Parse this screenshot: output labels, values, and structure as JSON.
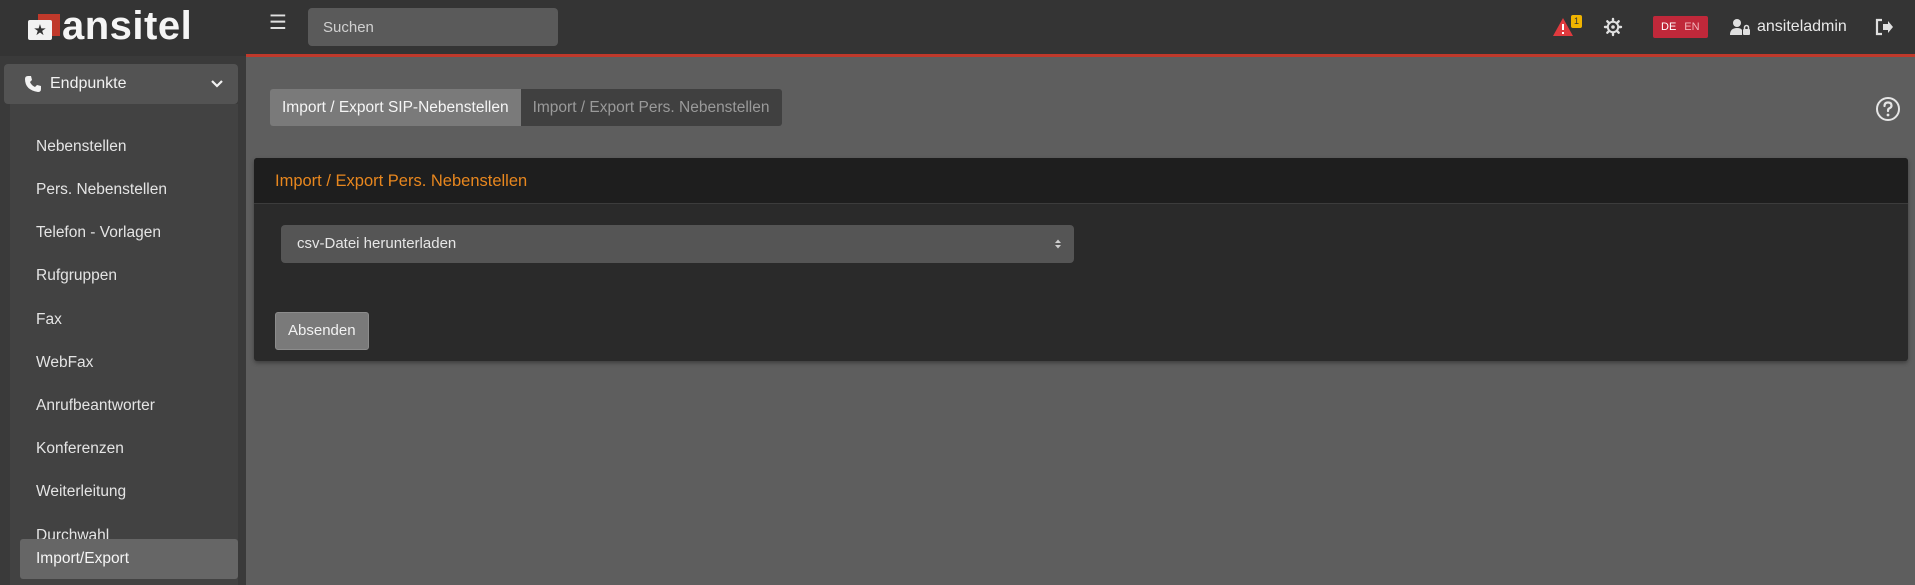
{
  "header": {
    "logo_text": "ansitel",
    "search_placeholder": "Suchen",
    "alerts_count": "1",
    "lang_active": "DE",
    "lang_other": "EN",
    "username": "ansiteladmin"
  },
  "sidebar": {
    "section_label": "Endpunkte",
    "items": [
      {
        "label": "Nebenstellen"
      },
      {
        "label": "Pers. Nebenstellen"
      },
      {
        "label": "Telefon - Vorlagen"
      },
      {
        "label": "Rufgruppen"
      },
      {
        "label": "Fax"
      },
      {
        "label": "WebFax"
      },
      {
        "label": "Anrufbeantworter"
      },
      {
        "label": "Konferenzen"
      },
      {
        "label": "Weiterleitung"
      },
      {
        "label": "Durchwahl"
      },
      {
        "label": "Import/Export"
      }
    ],
    "active_item": "Import/Export"
  },
  "main": {
    "tabs": [
      {
        "label": "Import / Export SIP-Nebenstellen",
        "active": true
      },
      {
        "label": "Import / Export Pers. Nebenstellen",
        "active": false
      }
    ],
    "card_title": "Import / Export Pers. Nebenstellen",
    "select_value": "csv-Datei herunterladen",
    "submit_label": "Absenden"
  },
  "colors": {
    "accent_orange": "#e8871e",
    "topbar_red_line": "#c0392b",
    "alert_red": "#e03a3e",
    "badge_yellow": "#f0b400",
    "lang_red": "#c0283a"
  },
  "icons": [
    "logo-star-icon",
    "hamburger-icon",
    "alert-triangle-icon",
    "gear-icon",
    "user-lock-icon",
    "logout-icon",
    "phone-icon",
    "chevron-down-icon",
    "help-circle-icon",
    "select-arrows-icon"
  ]
}
